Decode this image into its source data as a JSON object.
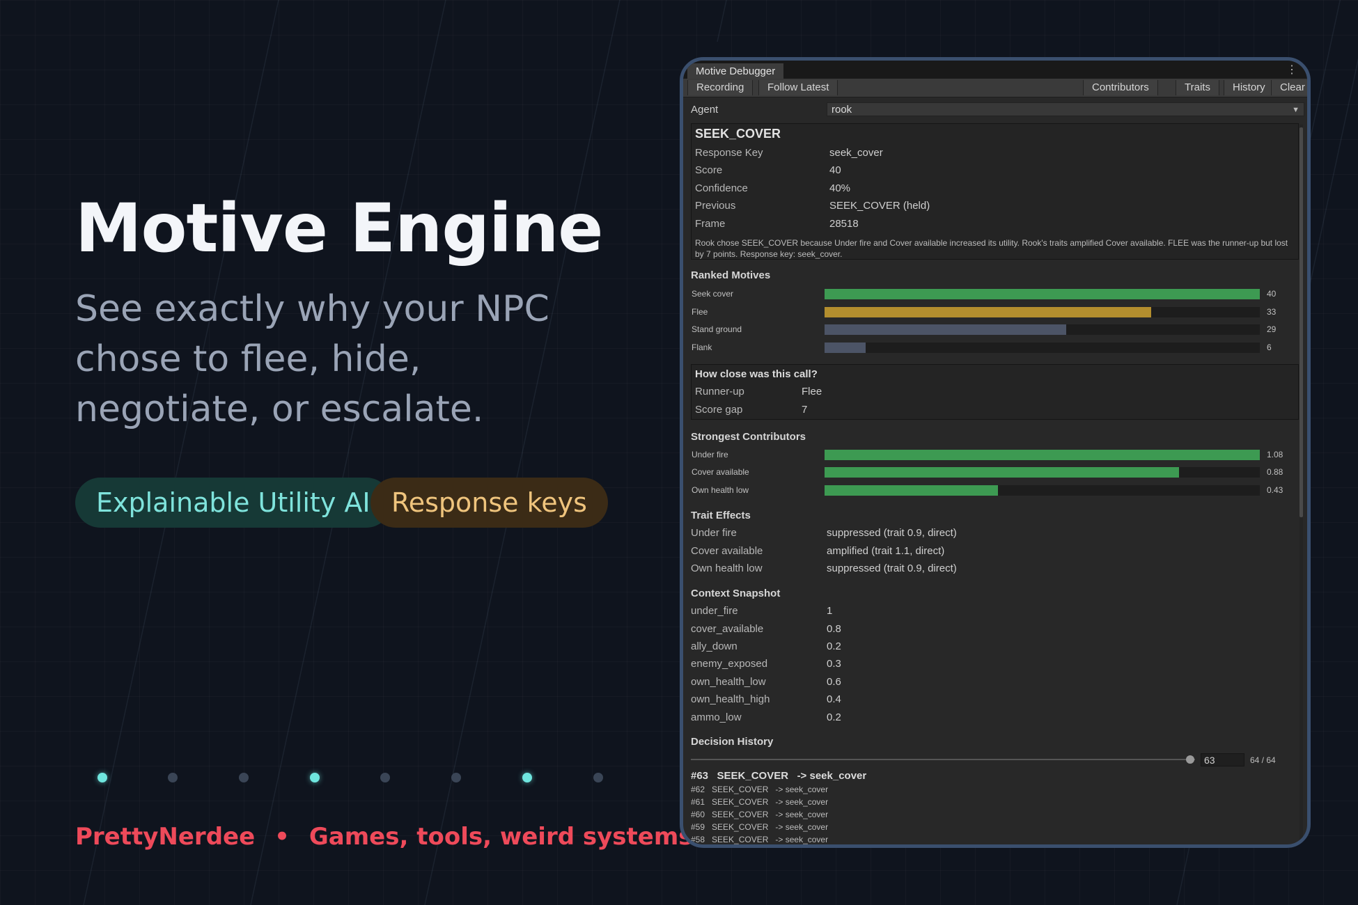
{
  "hero": {
    "title": "Motive Engine",
    "subtitle_lines": [
      "See exactly why your NPC",
      "chose to flee, hide,",
      "negotiate, or escalate."
    ],
    "pills": [
      {
        "label": "Explainable Utility AI",
        "color": "#7fe3dc"
      },
      {
        "label": "Response keys",
        "color": "#efc47d"
      }
    ]
  },
  "footer": {
    "brand": "PrettyNerdee",
    "separator": "•",
    "tagline": "Games, tools, weird systems.",
    "brand_color": "#ee4a5a",
    "dots_active": [
      true,
      false,
      false,
      true,
      false,
      false,
      true,
      false
    ]
  },
  "window": {
    "title": "Motive Debugger",
    "toolbar_left": [
      "Recording",
      "Follow Latest"
    ],
    "toolbar_right": [
      "Contributors",
      "Traits",
      "History",
      "Clear"
    ],
    "agent": {
      "label": "Agent",
      "value": "rook"
    }
  },
  "decision": {
    "name": "SEEK_COVER",
    "fields": [
      {
        "label": "Response Key",
        "value": "seek_cover"
      },
      {
        "label": "Score",
        "value": "40"
      },
      {
        "label": "Confidence",
        "value": "40%"
      },
      {
        "label": "Previous",
        "value": "SEEK_COVER   (held)"
      },
      {
        "label": "Frame",
        "value": "28518"
      }
    ],
    "explanation": "Rook chose SEEK_COVER because Under fire and Cover available increased its utility. Rook's traits amplified Cover available. FLEE was the runner-up but lost by 7 points. Response key: seek_cover."
  },
  "ranked_motives": {
    "title": "Ranked Motives",
    "max": 40,
    "items": [
      {
        "label": "Seek cover",
        "value": 40,
        "display": "40",
        "color": "#3d9a52"
      },
      {
        "label": "Flee",
        "value": 30,
        "display": "33",
        "color": "#b38e2e"
      },
      {
        "label": "Stand ground",
        "value": 22.2,
        "display": "29",
        "color": "#4c5466"
      },
      {
        "label": "Flank",
        "value": 3.8,
        "display": "6",
        "color": "#4c5466"
      }
    ]
  },
  "closeness": {
    "title": "How close was this call?",
    "fields": [
      {
        "label": "Runner-up",
        "value": "Flee"
      },
      {
        "label": "Score gap",
        "value": "7"
      }
    ]
  },
  "contributors": {
    "title": "Strongest Contributors",
    "max": 1.08,
    "items": [
      {
        "label": "Under fire",
        "value": 1.08,
        "display": "1.08",
        "color": "#3d9a52"
      },
      {
        "label": "Cover available",
        "value": 0.88,
        "display": "0.88",
        "color": "#3d9a52"
      },
      {
        "label": "Own health low",
        "value": 0.43,
        "display": "0.43",
        "color": "#3d9a52"
      }
    ]
  },
  "traits": {
    "title": "Trait Effects",
    "items": [
      {
        "label": "Under fire",
        "value": "suppressed   (trait 0.9, direct)"
      },
      {
        "label": "Cover available",
        "value": "amplified   (trait 1.1, direct)"
      },
      {
        "label": "Own health low",
        "value": "suppressed   (trait 0.9, direct)"
      }
    ]
  },
  "context": {
    "title": "Context Snapshot",
    "items": [
      {
        "label": "under_fire",
        "value": "1"
      },
      {
        "label": "cover_available",
        "value": "0.8"
      },
      {
        "label": "ally_down",
        "value": "0.2"
      },
      {
        "label": "enemy_exposed",
        "value": "0.3"
      },
      {
        "label": "own_health_low",
        "value": "0.6"
      },
      {
        "label": "own_health_high",
        "value": "0.4"
      },
      {
        "label": "ammo_low",
        "value": "0.2"
      }
    ]
  },
  "history": {
    "title": "Decision History",
    "slider_value": "63",
    "slider_position": 1.0,
    "count": "64 / 64",
    "head": "#63   SEEK_COVER   -> seek_cover",
    "rows": [
      "#62   SEEK_COVER   -> seek_cover",
      "#61   SEEK_COVER   -> seek_cover",
      "#60   SEEK_COVER   -> seek_cover",
      "#59   SEEK_COVER   -> seek_cover",
      "#58   SEEK_COVER   -> seek_cover"
    ]
  }
}
